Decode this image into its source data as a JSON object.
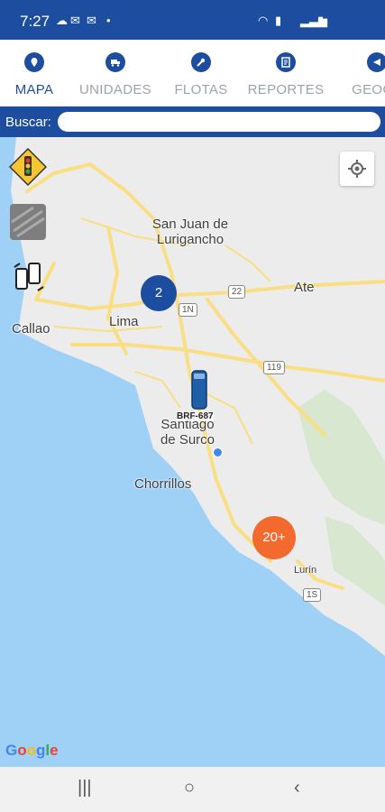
{
  "status_bar": {
    "time": "7:27"
  },
  "tabs": [
    {
      "label": "MAPA",
      "icon": "map-pin-icon",
      "active": true
    },
    {
      "label": "UNIDADES",
      "icon": "truck-icon",
      "active": false
    },
    {
      "label": "FLOTAS",
      "icon": "wrench-icon",
      "active": false
    },
    {
      "label": "REPORTES",
      "icon": "report-icon",
      "active": false
    },
    {
      "label": "GEOCE",
      "icon": "geofence-icon",
      "active": false
    }
  ],
  "search": {
    "label": "Buscar:",
    "value": ""
  },
  "map": {
    "places": {
      "sjl": "San Juan de\nLurigancho",
      "ate": "Ate",
      "lima": "Lima",
      "callao": "Callao",
      "surco": "Santiago\nde Surco",
      "chorrillos": "Chorrillos",
      "lurin": "Lurín"
    },
    "shields": {
      "a": "22",
      "b": "1N",
      "c": "119",
      "d": "1S"
    },
    "clusters": {
      "blue": "2",
      "orange": "20+"
    },
    "vehicle_plate": "BRF-687",
    "google_logo": "Google",
    "colors": {
      "water": "#9fd1f7",
      "land": "#ececec",
      "road": "#f9de84",
      "brand": "#1d4d9e",
      "cluster_orange": "#f26a2e"
    }
  }
}
